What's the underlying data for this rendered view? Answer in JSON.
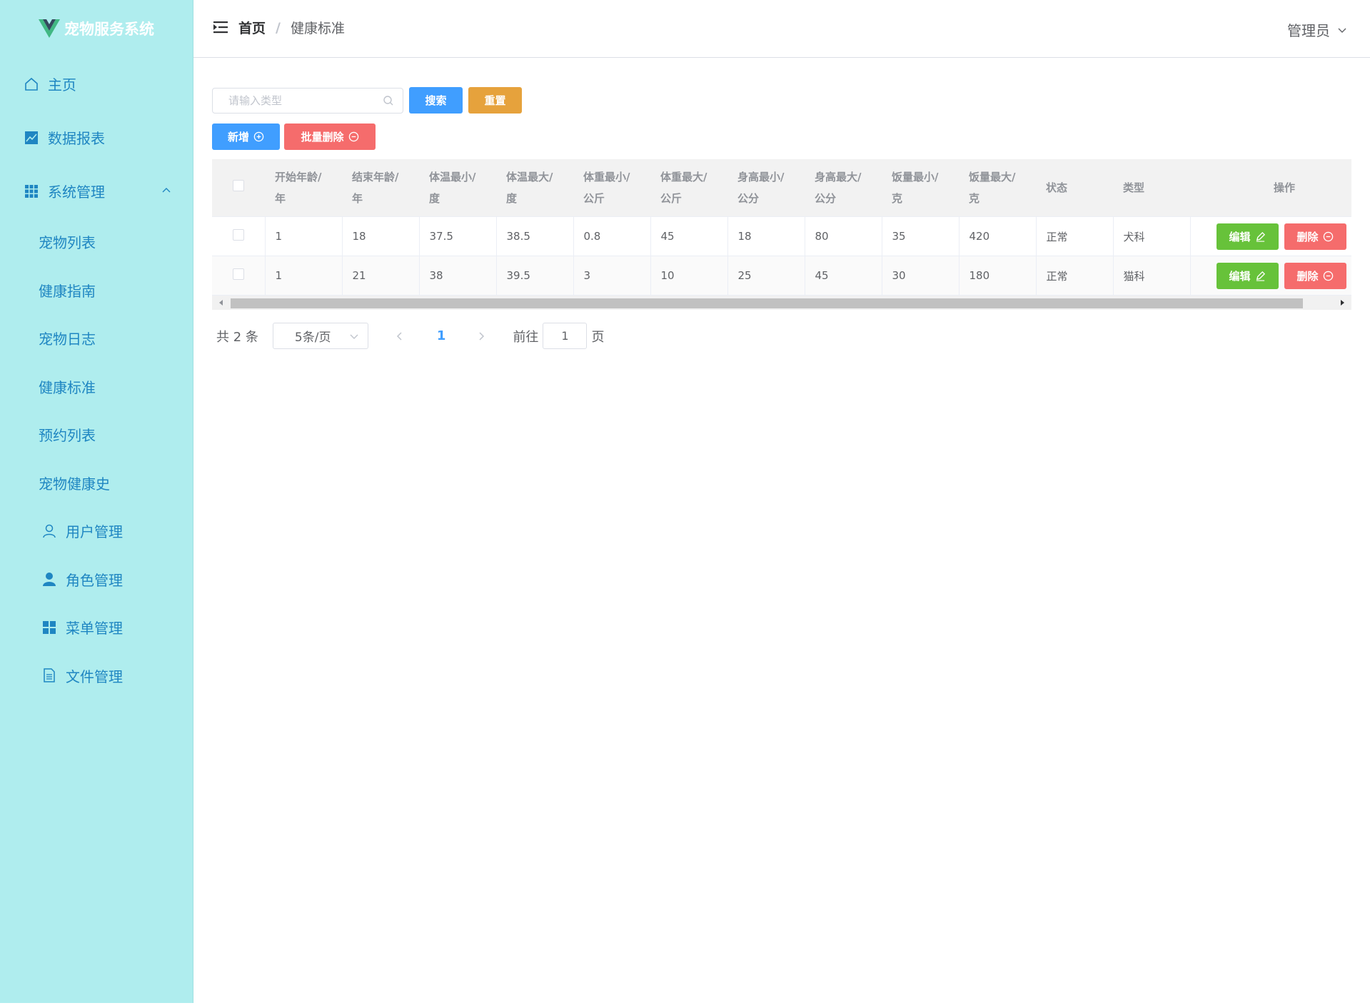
{
  "app": {
    "title": "宠物服务系统"
  },
  "sidebar": {
    "items": [
      {
        "label": "主页",
        "icon": "home-icon"
      },
      {
        "label": "数据报表",
        "icon": "chart-icon"
      },
      {
        "label": "系统管理",
        "icon": "grid-icon",
        "expanded": true
      }
    ],
    "sub_items": [
      {
        "label": "宠物列表"
      },
      {
        "label": "健康指南"
      },
      {
        "label": "宠物日志"
      },
      {
        "label": "健康标准"
      },
      {
        "label": "预约列表"
      },
      {
        "label": "宠物健康史"
      },
      {
        "label": "用户管理",
        "icon": "user-icon"
      },
      {
        "label": "角色管理",
        "icon": "user-filled-icon"
      },
      {
        "label": "菜单管理",
        "icon": "menu-grid-icon"
      },
      {
        "label": "文件管理",
        "icon": "document-icon"
      }
    ]
  },
  "header": {
    "breadcrumb": {
      "home": "首页",
      "separator": "/",
      "current": "健康标准"
    },
    "user": "管理员"
  },
  "search": {
    "placeholder": "请输入类型",
    "value": "",
    "search_label": "搜索",
    "reset_label": "重置"
  },
  "actions": {
    "add_label": "新增",
    "batch_delete_label": "批量删除"
  },
  "table": {
    "columns": [
      "开始年龄/年",
      "结束年龄/年",
      "体温最小/度",
      "体温最大/度",
      "体重最小/公斤",
      "体重最大/公斤",
      "身高最小/公分",
      "身高最大/公分",
      "饭量最小/克",
      "饭量最大/克",
      "状态",
      "类型",
      "操作"
    ],
    "columns_line1": [
      "开始年龄/",
      "结束年龄/",
      "体温最小/",
      "体温最大/",
      "体重最小/",
      "体重最大/",
      "身高最小/",
      "身高最大/",
      "饭量最小/",
      "饭量最大/"
    ],
    "columns_line2": [
      "年",
      "年",
      "度",
      "度",
      "公斤",
      "公斤",
      "公分",
      "公分",
      "克",
      "克"
    ],
    "rows": [
      [
        "1",
        "18",
        "37.5",
        "38.5",
        "0.8",
        "45",
        "18",
        "80",
        "35",
        "420",
        "正常",
        "犬科"
      ],
      [
        "1",
        "21",
        "38",
        "39.5",
        "3",
        "10",
        "25",
        "45",
        "30",
        "180",
        "正常",
        "猫科"
      ]
    ],
    "edit_label": "编辑",
    "delete_label": "删除"
  },
  "pagination": {
    "total_text": "共 2 条",
    "page_size": "5条/页",
    "current_page": "1",
    "goto_label": "前往",
    "goto_value": "1",
    "page_suffix": "页"
  },
  "colors": {
    "sidebar_bg": "#afedee",
    "sidebar_text": "#1f86c2",
    "primary": "#409eff",
    "warning": "#e6a23c",
    "danger": "#f56c6c",
    "success": "#67c23a"
  }
}
